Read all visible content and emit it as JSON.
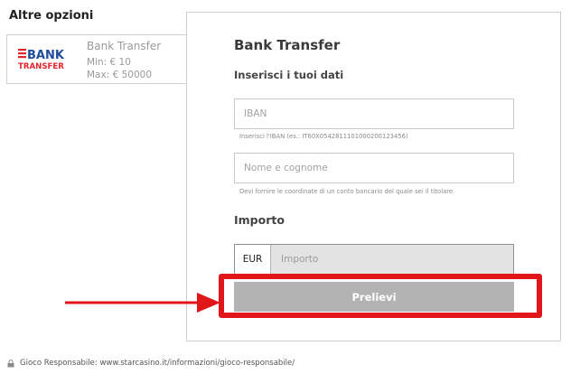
{
  "left_panel": {
    "title": "Altre opzioni",
    "method": {
      "logo_line1": "BANK",
      "logo_line2": "TRANSFER",
      "name": "Bank Transfer",
      "min": "Min: € 10",
      "max": "Max: € 50000"
    }
  },
  "form": {
    "title": "Bank Transfer",
    "subtitle": "Inserisci i tuoi dati",
    "iban": {
      "placeholder": "IBAN",
      "hint": "Inserisci l'IBAN (es.: IT60X0542811101000200123456)"
    },
    "name": {
      "placeholder": "Nome e cognome",
      "hint": "Devi fornire le coordinate di un conto bancario del quale sei il titolare"
    },
    "amount": {
      "label": "Importo",
      "currency": "EUR",
      "placeholder": "Importo"
    },
    "submit_label": "Prelievi"
  },
  "footer": {
    "text": "Gioco Responsabile: www.starcasino.it/informazioni/gioco-responsabile/"
  },
  "colors": {
    "logo_blue": "#1f4e9c",
    "logo_red": "#e0252b",
    "highlight_red": "#e0161b",
    "button_gray": "#b3b3b3"
  },
  "icons": {
    "footer": "lock-icon",
    "annotation": "arrow-right-icon"
  }
}
